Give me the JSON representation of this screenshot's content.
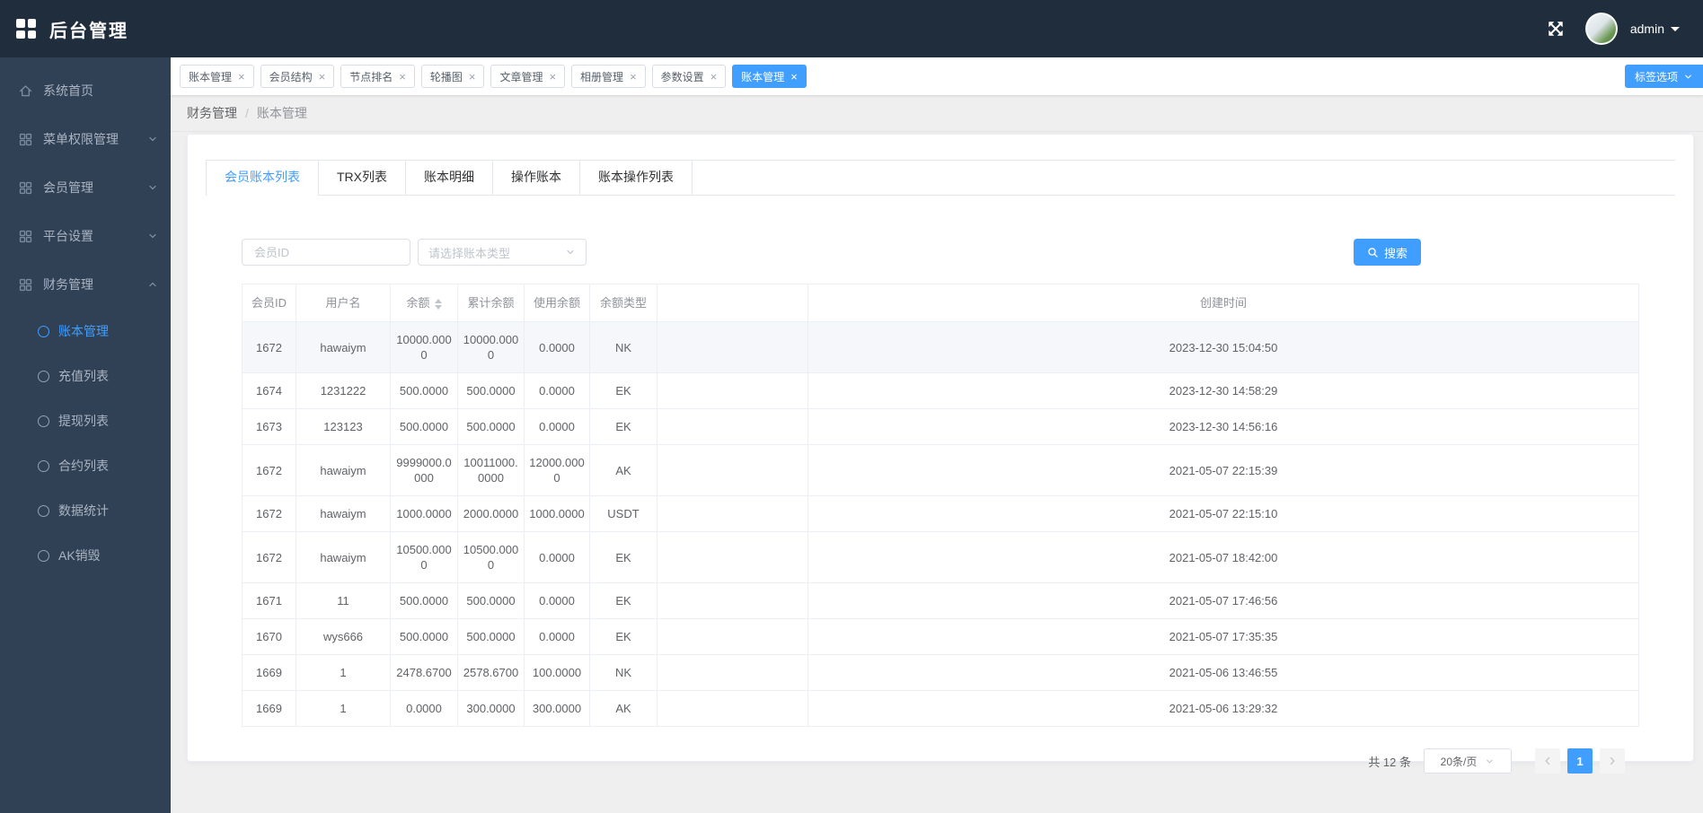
{
  "colors": {
    "accent": "#409eff",
    "header_bg": "#1f2d3d",
    "sidebar_bg": "#304156",
    "page_bg": "#efefef",
    "highlight_row_bg": "#f5f7fa"
  },
  "header": {
    "title": "后台管理",
    "logo_icon": "dashboard-grid-icon",
    "fullscreen_icon": "fullscreen-icon",
    "user": {
      "name": "admin",
      "caret_icon": "caret-down-icon",
      "avatar": "user-avatar"
    }
  },
  "sidebar": {
    "items": [
      {
        "label": "系统首页",
        "icon": "home-icon"
      },
      {
        "label": "菜单权限管理",
        "icon": "grid-icon",
        "chevron": "chevron-down-icon"
      },
      {
        "label": "会员管理",
        "icon": "grid-icon",
        "chevron": "chevron-down-icon"
      },
      {
        "label": "平台设置",
        "icon": "grid-icon",
        "chevron": "chevron-down-icon"
      },
      {
        "label": "财务管理",
        "icon": "grid-icon",
        "chevron": "chevron-up-icon",
        "expanded": true,
        "children": [
          {
            "label": "账本管理",
            "icon": "circle-outline-icon",
            "active": true
          },
          {
            "label": "充值列表",
            "icon": "circle-outline-icon",
            "active": false
          },
          {
            "label": "提现列表",
            "icon": "circle-outline-icon",
            "active": false
          },
          {
            "label": "合约列表",
            "icon": "circle-outline-icon",
            "active": false
          },
          {
            "label": "数据统计",
            "icon": "circle-outline-icon",
            "active": false
          },
          {
            "label": "AK销毁",
            "icon": "circle-outline-icon",
            "active": false
          }
        ]
      }
    ]
  },
  "tabbar": {
    "close_icon": "close-icon",
    "tabs": [
      {
        "label": "账本管理",
        "active": false
      },
      {
        "label": "会员结构",
        "active": false
      },
      {
        "label": "节点排名",
        "active": false
      },
      {
        "label": "轮播图",
        "active": false
      },
      {
        "label": "文章管理",
        "active": false
      },
      {
        "label": "相册管理",
        "active": false
      },
      {
        "label": "参数设置",
        "active": false
      },
      {
        "label": "账本管理",
        "active": true
      }
    ],
    "options_button": {
      "label": "标签选项",
      "chevron": "chevron-down-icon"
    }
  },
  "breadcrumb": {
    "items": [
      "财务管理",
      "账本管理"
    ],
    "separator": "/"
  },
  "content": {
    "tabs": [
      {
        "label": "会员账本列表",
        "active": true
      },
      {
        "label": "TRX列表",
        "active": false
      },
      {
        "label": "账本明细",
        "active": false
      },
      {
        "label": "操作账本",
        "active": false
      },
      {
        "label": "账本操作列表",
        "active": false
      }
    ],
    "search": {
      "member_id_placeholder": "会员ID",
      "account_type_placeholder": "请选择账本类型",
      "button_label": "搜索",
      "button_icon": "search-icon"
    },
    "table": {
      "columns": [
        {
          "label": "会员ID",
          "sortable": false
        },
        {
          "label": "用户名",
          "sortable": false
        },
        {
          "label": "余额",
          "sortable": true
        },
        {
          "label": "累计余额",
          "sortable": false
        },
        {
          "label": "使用余额",
          "sortable": false
        },
        {
          "label": "余额类型",
          "sortable": false
        },
        {
          "label": "",
          "sortable": false
        },
        {
          "label": "创建时间",
          "sortable": false
        }
      ],
      "highlighted_row_index": 0,
      "rows": [
        [
          "1672",
          "hawaiym",
          "10000.0000",
          "10000.0000",
          "0.0000",
          "NK",
          "",
          "2023-12-30 15:04:50"
        ],
        [
          "1674",
          "1231222",
          "500.0000",
          "500.0000",
          "0.0000",
          "EK",
          "",
          "2023-12-30 14:58:29"
        ],
        [
          "1673",
          "123123",
          "500.0000",
          "500.0000",
          "0.0000",
          "EK",
          "",
          "2023-12-30 14:56:16"
        ],
        [
          "1672",
          "hawaiym",
          "9999000.0000",
          "10011000.0000",
          "12000.0000",
          "AK",
          "",
          "2021-05-07 22:15:39"
        ],
        [
          "1672",
          "hawaiym",
          "1000.0000",
          "2000.0000",
          "1000.0000",
          "USDT",
          "",
          "2021-05-07 22:15:10"
        ],
        [
          "1672",
          "hawaiym",
          "10500.0000",
          "10500.0000",
          "0.0000",
          "EK",
          "",
          "2021-05-07 18:42:00"
        ],
        [
          "1671",
          "11",
          "500.0000",
          "500.0000",
          "0.0000",
          "EK",
          "",
          "2021-05-07 17:46:56"
        ],
        [
          "1670",
          "wys666",
          "500.0000",
          "500.0000",
          "0.0000",
          "EK",
          "",
          "2021-05-07 17:35:35"
        ],
        [
          "1669",
          "1",
          "2478.6700",
          "2578.6700",
          "100.0000",
          "NK",
          "",
          "2021-05-06 13:46:55"
        ],
        [
          "1669",
          "1",
          "0.0000",
          "300.0000",
          "300.0000",
          "AK",
          "",
          "2021-05-06 13:29:32"
        ]
      ]
    },
    "pagination": {
      "total_label": "共 12 条",
      "page_size_label": "20条/页",
      "current_page": "1",
      "prev_icon": "chevron-left-icon",
      "next_icon": "chevron-right-icon"
    }
  }
}
